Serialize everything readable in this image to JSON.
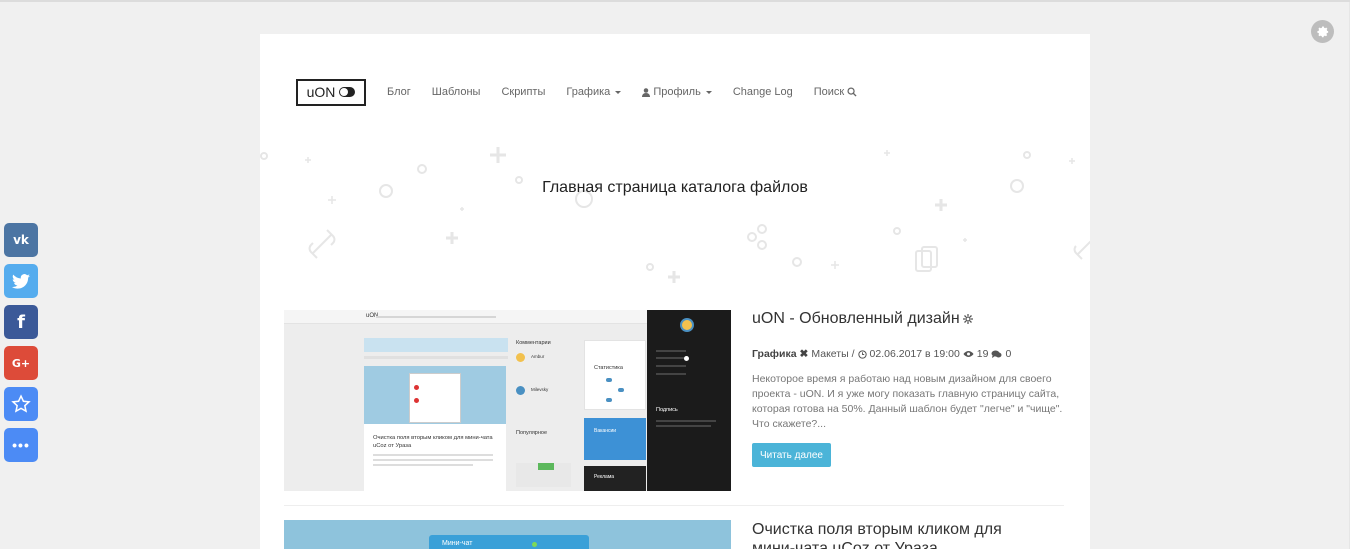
{
  "nav": {
    "logo": "uON",
    "items": [
      "Блог",
      "Шаблоны",
      "Скрипты",
      "Графика",
      "Профиль",
      "Change Log",
      "Поиск"
    ]
  },
  "hero": {
    "title": "Главная страница каталога файлов"
  },
  "share": [
    "vk-icon",
    "twitter-icon",
    "facebook-icon",
    "googleplus-icon",
    "favorite-icon",
    "more-icon"
  ],
  "post1": {
    "title": "uON - Обновленный дизайн",
    "category1": "Графика",
    "category2": "Макеты",
    "date": "02.06.2017 в 19:00",
    "views": "19",
    "comments": "0",
    "excerpt": "Некоторое время я работаю над новым дизайном для своего проекта - uON. И я уже могу показать главную страницу сайта, которая готова на 50%. Данный шаблон будет \"легче\" и \"чище\". Что скажете?...",
    "read_more": "Читать далее",
    "thumb": {
      "header_logo": "uON",
      "comments_title": "Комментарии",
      "c1_name": "Ambur",
      "c2_name": "Milevsky",
      "stats_title": "Статистика",
      "popular_title": "Популярное",
      "banner_text": "Вакансии",
      "ad_title": "Реклама",
      "subscribe_title": "Подпись",
      "card_title": "Очистка поля вторым кликом для мини-чата uCoz от Уразa"
    }
  },
  "post2": {
    "title_line1": "Очистка поля вторым кликом для",
    "title_line2": "мини-чата uCoz от Уразa",
    "thumb_chat": "Мини-чат"
  },
  "colors": {
    "accent": "#4bb4d8",
    "vk": "#4c75a3",
    "twitter": "#55acee",
    "facebook": "#3b5998",
    "googleplus": "#dd4b39",
    "favorite": "#4c8bf5",
    "more": "#4c8bf5"
  }
}
